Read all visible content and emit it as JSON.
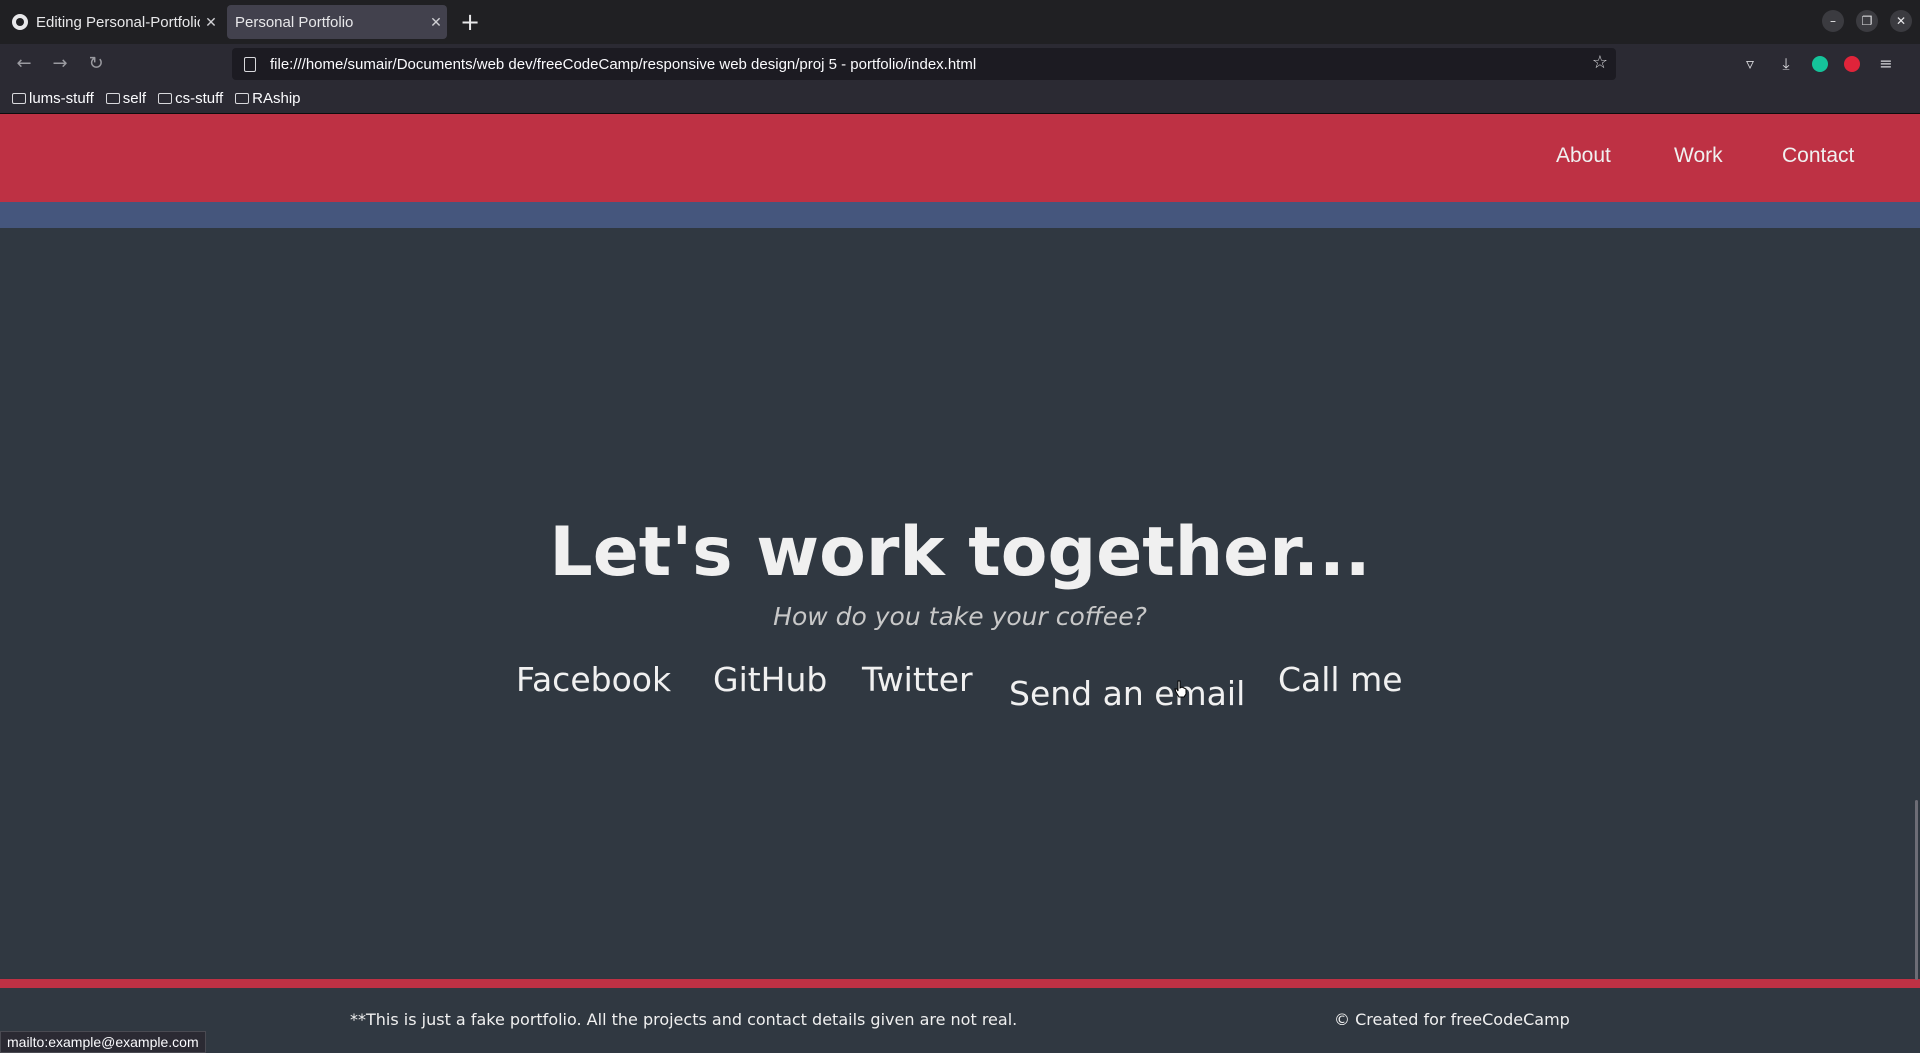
{
  "browser": {
    "tabs": [
      {
        "title": "Editing Personal-Portfolio",
        "icon": "github-icon"
      },
      {
        "title": "Personal Portfolio"
      }
    ],
    "url": "file:///home/sumair/Documents/web dev/freeCodeCamp/responsive web design/proj 5 - portfolio/index.html",
    "bookmarks": [
      "lums-stuff",
      "self",
      "cs-stuff",
      "RAship"
    ],
    "status": "mailto:example@example.com"
  },
  "site": {
    "nav": [
      "About",
      "Work",
      "Contact"
    ],
    "heading": "Let's work together...",
    "subheading": "How do you take your coffee?",
    "links": [
      "Facebook",
      "GitHub",
      "Twitter",
      "Send an email",
      "Call me"
    ],
    "footer_note": "**This is just a fake portfolio. All the projects and contact details given are not real.",
    "footer_credit": "© Created for freeCodeCamp",
    "colors": {
      "accent": "#be3144",
      "stripe": "#45567d",
      "background": "#303841"
    }
  }
}
